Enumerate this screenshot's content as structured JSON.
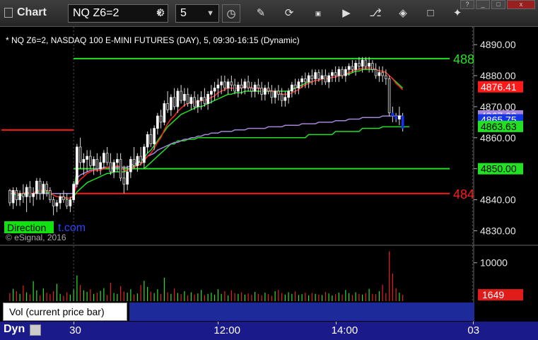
{
  "app": {
    "title": "Chart"
  },
  "toolbar": {
    "symbol": "NQ Z6=2",
    "interval": "5",
    "icons": [
      "settings-icon",
      "clock-icon",
      "pencil-icon",
      "refresh-icon",
      "get-icon",
      "play-icon",
      "link-icon",
      "comment-icon",
      "twitter-icon"
    ]
  },
  "chart_data": {
    "type": "candlestick",
    "title": "* NQ Z6=2, NASDAQ 100 E-MINI FUTURES (DAY), 5, 09:30-16:15 (Dynamic)",
    "ylim": [
      4826,
      4893
    ],
    "yticks": [
      "4890.00",
      "4880.00",
      "4870.00",
      "4860.00",
      "4850.00",
      "4840.00",
      "4830.00"
    ],
    "price_labels": [
      {
        "text": "4876.41",
        "value": 4876.41,
        "color": "#ff1a1a"
      },
      {
        "text": "4867.03",
        "value": 4867.03,
        "color": "#a585d8"
      },
      {
        "text": "4865.75",
        "value": 4865.75,
        "color": "#1535e8"
      },
      {
        "text": "4863.63",
        "value": 4863.63,
        "color": "#22e022"
      },
      {
        "text": "4850.00",
        "value": 4850.0,
        "color": "#22e022"
      }
    ],
    "level_lines": [
      {
        "value": 4862.5,
        "color": "#ff1a1a",
        "from": 0,
        "to": 21,
        "label": ""
      },
      {
        "value": 4885.5,
        "color": "#22e022",
        "from": 21,
        "to": 140,
        "label": "488"
      },
      {
        "value": 4850.0,
        "color": "#22e022",
        "from": 21,
        "to": 140,
        "label": ""
      },
      {
        "value": 4842.0,
        "color": "#ff1a1a",
        "from": 21,
        "to": 140,
        "label": "484"
      }
    ],
    "candles": [
      [
        4843,
        4843.5,
        4838,
        4839
      ],
      [
        4839,
        4844,
        4837,
        4843
      ],
      [
        4843,
        4844,
        4838,
        4840
      ],
      [
        4840,
        4843,
        4838,
        4842
      ],
      [
        4842,
        4845,
        4839,
        4841
      ],
      [
        4841,
        4845,
        4836,
        4844
      ],
      [
        4844,
        4846,
        4839,
        4841
      ],
      [
        4841,
        4844,
        4838,
        4842
      ],
      [
        4842,
        4847,
        4840,
        4846
      ],
      [
        4846,
        4847,
        4840,
        4842
      ],
      [
        4842,
        4846,
        4840,
        4845
      ],
      [
        4845,
        4846,
        4841,
        4843
      ],
      [
        4843,
        4844,
        4839,
        4840
      ],
      [
        4840,
        4841,
        4835,
        4838
      ],
      [
        4838,
        4840,
        4836,
        4839
      ],
      [
        4839,
        4842,
        4837,
        4841
      ],
      [
        4841,
        4843,
        4839,
        4840
      ],
      [
        4840,
        4842,
        4837,
        4838
      ],
      [
        4838,
        4841,
        4836,
        4840
      ],
      [
        4840,
        4846,
        4839,
        4845
      ],
      [
        4845,
        4858,
        4844,
        4857
      ],
      [
        4857,
        4860,
        4850,
        4852
      ],
      [
        4852,
        4855,
        4848,
        4853
      ],
      [
        4853,
        4856,
        4849,
        4854
      ],
      [
        4854,
        4856,
        4850,
        4851
      ],
      [
        4851,
        4854,
        4848,
        4853
      ],
      [
        4853,
        4855,
        4849,
        4850
      ],
      [
        4850,
        4854,
        4848,
        4852
      ],
      [
        4852,
        4856,
        4850,
        4855
      ],
      [
        4855,
        4857,
        4851,
        4852
      ],
      [
        4852,
        4855,
        4848,
        4849
      ],
      [
        4849,
        4853,
        4847,
        4852
      ],
      [
        4852,
        4855,
        4849,
        4853
      ],
      [
        4853,
        4855,
        4846,
        4847
      ],
      [
        4847,
        4851,
        4842,
        4845
      ],
      [
        4845,
        4851,
        4843,
        4849
      ],
      [
        4849,
        4854,
        4847,
        4853
      ],
      [
        4853,
        4857,
        4850,
        4851
      ],
      [
        4851,
        4855,
        4849,
        4854
      ],
      [
        4854,
        4857,
        4851,
        4852
      ],
      [
        4852,
        4858,
        4850,
        4857
      ],
      [
        4857,
        4862,
        4855,
        4861
      ],
      [
        4861,
        4863,
        4857,
        4858
      ],
      [
        4858,
        4864,
        4856,
        4863
      ],
      [
        4863,
        4868,
        4861,
        4867
      ],
      [
        4867,
        4869,
        4863,
        4865
      ],
      [
        4865,
        4872,
        4864,
        4871
      ],
      [
        4871,
        4875,
        4868,
        4869
      ],
      [
        4869,
        4874,
        4867,
        4873
      ],
      [
        4873,
        4876,
        4869,
        4870
      ],
      [
        4870,
        4876,
        4868,
        4875
      ],
      [
        4875,
        4877,
        4871,
        4872
      ],
      [
        4872,
        4876,
        4870,
        4874
      ],
      [
        4874,
        4876,
        4870,
        4871
      ],
      [
        4871,
        4874,
        4869,
        4873
      ],
      [
        4873,
        4875,
        4869,
        4870
      ],
      [
        4870,
        4874,
        4868,
        4872
      ],
      [
        4872,
        4875,
        4869,
        4873
      ],
      [
        4873,
        4876,
        4870,
        4871
      ],
      [
        4871,
        4875,
        4869,
        4874
      ],
      [
        4874,
        4877,
        4871,
        4875
      ],
      [
        4875,
        4878,
        4872,
        4876
      ],
      [
        4876,
        4879,
        4873,
        4877
      ],
      [
        4877,
        4880,
        4874,
        4878
      ],
      [
        4878,
        4880,
        4875,
        4876
      ],
      [
        4876,
        4879,
        4874,
        4878
      ],
      [
        4878,
        4880,
        4875,
        4877
      ],
      [
        4877,
        4879,
        4874,
        4875
      ],
      [
        4875,
        4878,
        4873,
        4877
      ],
      [
        4877,
        4879,
        4874,
        4876
      ],
      [
        4876,
        4879,
        4874,
        4878
      ],
      [
        4878,
        4880,
        4875,
        4876
      ],
      [
        4876,
        4878,
        4873,
        4875
      ],
      [
        4875,
        4878,
        4873,
        4877
      ],
      [
        4877,
        4879,
        4874,
        4876
      ],
      [
        4876,
        4878,
        4872,
        4874
      ],
      [
        4874,
        4877,
        4872,
        4876
      ],
      [
        4876,
        4878,
        4874,
        4875
      ],
      [
        4875,
        4877,
        4871,
        4873
      ],
      [
        4873,
        4876,
        4871,
        4875
      ],
      [
        4875,
        4877,
        4872,
        4874
      ],
      [
        4874,
        4876,
        4870,
        4872
      ],
      [
        4872,
        4875,
        4870,
        4873
      ],
      [
        4873,
        4876,
        4871,
        4875
      ],
      [
        4875,
        4878,
        4873,
        4877
      ],
      [
        4877,
        4879,
        4874,
        4876
      ],
      [
        4876,
        4879,
        4874,
        4878
      ],
      [
        4878,
        4880,
        4876,
        4879
      ],
      [
        4879,
        4881,
        4876,
        4878
      ],
      [
        4878,
        4881,
        4876,
        4880
      ],
      [
        4880,
        4882,
        4877,
        4879
      ],
      [
        4879,
        4882,
        4877,
        4881
      ],
      [
        4881,
        4882,
        4878,
        4879
      ],
      [
        4879,
        4882,
        4877,
        4880
      ],
      [
        4880,
        4882,
        4877,
        4878
      ],
      [
        4878,
        4881,
        4876,
        4880
      ],
      [
        4880,
        4882,
        4878,
        4881
      ],
      [
        4881,
        4883,
        4878,
        4880
      ],
      [
        4880,
        4883,
        4878,
        4882
      ],
      [
        4882,
        4883,
        4879,
        4880
      ],
      [
        4880,
        4883,
        4878,
        4882
      ],
      [
        4882,
        4884,
        4880,
        4883
      ],
      [
        4883,
        4885,
        4881,
        4882
      ],
      [
        4882,
        4885,
        4880,
        4884
      ],
      [
        4884,
        4886,
        4882,
        4883
      ],
      [
        4883,
        4886,
        4881,
        4885
      ],
      [
        4885,
        4886,
        4882,
        4883
      ],
      [
        4883,
        4886,
        4881,
        4884
      ],
      [
        4884,
        4885,
        4881,
        4882
      ],
      [
        4882,
        4884,
        4879,
        4880
      ],
      [
        4880,
        4883,
        4878,
        4881
      ],
      [
        4881,
        4883,
        4878,
        4880
      ],
      [
        4880,
        4882,
        4877,
        4879
      ],
      [
        4879,
        4880,
        4867,
        4868
      ],
      [
        4868,
        4870,
        4865,
        4867
      ],
      [
        4867,
        4868,
        4865,
        4866
      ],
      [
        4866,
        4870,
        4864,
        4867
      ],
      [
        4867,
        4868,
        4862,
        4863
      ]
    ],
    "ema_red": [
      4843,
      4842.5,
      4842,
      4842,
      4842,
      4842.5,
      4842,
      4842,
      4843,
      4843,
      4843,
      4843,
      4842.5,
      4841.5,
      4841,
      4841,
      4841,
      4840.5,
      4840.5,
      4841.5,
      4845,
      4846.5,
      4847.5,
      4848.5,
      4849,
      4849.5,
      4849.5,
      4849.5,
      4850,
      4850.5,
      4850.5,
      4850.5,
      4851,
      4850.5,
      4849.5,
      4849.5,
      4850,
      4850.5,
      4851,
      4851.5,
      4852.5,
      4854,
      4855,
      4856.5,
      4858.5,
      4860,
      4862.5,
      4864.5,
      4866,
      4867,
      4868.5,
      4869.5,
      4870.5,
      4871,
      4871.5,
      4871.5,
      4871.5,
      4872,
      4872,
      4872.5,
      4873,
      4873.5,
      4874.5,
      4875,
      4875.5,
      4876,
      4876,
      4876,
      4876,
      4876,
      4876.5,
      4876.5,
      4876,
      4876,
      4876,
      4875.5,
      4875.5,
      4875.5,
      4875,
      4875,
      4874.5,
      4874,
      4874,
      4874,
      4874.5,
      4875,
      4875.5,
      4876.5,
      4877,
      4877.5,
      4878,
      4878.5,
      4878.5,
      4879,
      4879,
      4879,
      4879.5,
      4879.5,
      4880,
      4880,
      4880.5,
      4881,
      4881.5,
      4882,
      4882,
      4882.5,
      4882.5,
      4882.5,
      4882.5,
      4882,
      4881.5,
      4881.5,
      4881,
      4880,
      4879,
      4877.5,
      4876.5,
      4875.5
    ],
    "ema_green": [
      4842,
      4842,
      4841.5,
      4841.5,
      4841.5,
      4842,
      4842,
      4842,
      4842.5,
      4842.5,
      4842.5,
      4842.5,
      4842,
      4841.5,
      4841,
      4841,
      4840.5,
      4840.5,
      4840.5,
      4841,
      4842.5,
      4843.5,
      4844.5,
      4845.5,
      4846,
      4846.5,
      4847,
      4847.5,
      4848,
      4848.5,
      4848.5,
      4849,
      4849,
      4849,
      4849,
      4849.5,
      4850,
      4851,
      4851.5,
      4852.5,
      4853.5,
      4855,
      4856,
      4857.5,
      4859,
      4860.5,
      4862,
      4863.5,
      4864.5,
      4865.5,
      4866.5,
      4867.5,
      4868,
      4868.5,
      4869,
      4869.5,
      4870,
      4870,
      4870.5,
      4871,
      4871.5,
      4872,
      4872.5,
      4873,
      4873.5,
      4874,
      4874,
      4874.5,
      4874.5,
      4874.5,
      4875,
      4875,
      4875,
      4875,
      4875,
      4875,
      4875,
      4875,
      4875,
      4875,
      4875,
      4875,
      4875,
      4875,
      4875.5,
      4876,
      4876.5,
      4877,
      4877.5,
      4878,
      4878,
      4878.5,
      4878.5,
      4879,
      4879,
      4879,
      4879.5,
      4879.5,
      4880,
      4880,
      4880.5,
      4880.5,
      4881,
      4881.5,
      4881.5,
      4882,
      4882,
      4882,
      4882,
      4882,
      4881.5,
      4881.5,
      4881,
      4880,
      4879,
      4878,
      4877,
      4876
    ],
    "vwap_purple": [
      4842,
      4842,
      4842,
      4842,
      4842,
      4842,
      4842,
      4842,
      4842,
      4842,
      4842,
      4842,
      4842,
      4842,
      4842,
      4842,
      4842,
      4842,
      4842,
      4842,
      4847,
      4848,
      4848.5,
      4849,
      4849.5,
      4849.5,
      4850,
      4850,
      4850.5,
      4850.5,
      4850.5,
      4850.5,
      4850.5,
      4850.5,
      4850.5,
      4850.5,
      4851,
      4851.5,
      4852,
      4852.5,
      4853,
      4854,
      4854.5,
      4855,
      4856,
      4856.5,
      4857,
      4857.5,
      4858,
      4858.5,
      4858.5,
      4859,
      4859.5,
      4859.5,
      4860,
      4860,
      4860.5,
      4860.5,
      4861,
      4861,
      4861.5,
      4861.5,
      4861.5,
      4862,
      4862,
      4862,
      4862,
      4862.5,
      4862.5,
      4862.5,
      4862.5,
      4863,
      4863,
      4863,
      4863,
      4863,
      4863,
      4863.5,
      4863.5,
      4863.5,
      4863.5,
      4863.5,
      4864,
      4864,
      4864,
      4864,
      4864,
      4864.5,
      4864.5,
      4864.5,
      4864.5,
      4864.5,
      4865,
      4865,
      4865,
      4865,
      4865,
      4865.5,
      4865.5,
      4865.5,
      4865.5,
      4866,
      4866,
      4866,
      4866,
      4866.5,
      4866.5,
      4866.5,
      4866.5,
      4866.5,
      4866.5,
      4867,
      4867,
      4867,
      4867,
      4867,
      4867,
      4867
    ],
    "green_step": [
      4842,
      4842,
      4842,
      4842,
      4842,
      4842,
      4842,
      4842,
      4842,
      4842,
      4842,
      4842,
      4842,
      4842,
      4842,
      4842,
      4842,
      4842,
      4842,
      4842,
      4850,
      4850,
      4850,
      4850,
      4850,
      4850,
      4850,
      4850,
      4850,
      4850,
      4850,
      4850,
      4850,
      4850,
      4850,
      4850,
      4850,
      4850,
      4850,
      4850,
      4850,
      4851,
      4852,
      4853,
      4854,
      4855,
      4856,
      4857,
      4858,
      4858,
      4859,
      4859,
      4859,
      4859.5,
      4859.5,
      4859.5,
      4860,
      4860,
      4860,
      4860,
      4860,
      4860,
      4860,
      4860,
      4860,
      4860,
      4860,
      4860,
      4860,
      4860,
      4860,
      4860,
      4860,
      4860,
      4860,
      4860,
      4860,
      4860,
      4860,
      4860,
      4860,
      4860,
      4860,
      4860,
      4860,
      4860,
      4860,
      4860,
      4860,
      4861,
      4861,
      4861,
      4861,
      4861,
      4861,
      4861,
      4861,
      4862,
      4862,
      4862,
      4862,
      4862,
      4862,
      4862,
      4862,
      4863,
      4863,
      4863,
      4863,
      4863,
      4863,
      4863.5,
      4863.5,
      4863.5,
      4863.5,
      4863.5,
      4863.5,
      4863.5,
      4863.5,
      4863.5
    ],
    "volume": {
      "ylim": [
        0,
        14000
      ],
      "yticks": [
        "10000"
      ],
      "label_value": {
        "text": "1649",
        "value": 1649,
        "color": "#e11a1a"
      },
      "bars": [
        2100,
        3200,
        2600,
        1900,
        4100,
        2300,
        1700,
        5200,
        2800,
        1500,
        3300,
        2200,
        1800,
        2600,
        4500,
        1900,
        1400,
        2300,
        1700,
        3000,
        6700,
        4200,
        2800,
        2400,
        3100,
        1900,
        2200,
        2700,
        3400,
        1600,
        4800,
        2100,
        1900,
        3900,
        2500,
        2200,
        3100,
        1700,
        2000,
        4200,
        5300,
        3700,
        2500,
        2100,
        3100,
        1900,
        6100,
        2300,
        1900,
        3300,
        2100,
        1800,
        2600,
        1500,
        2300,
        1700,
        2000,
        2900,
        1600,
        1900,
        2200,
        1700,
        3100,
        1900,
        2600,
        1500,
        2800,
        2100,
        1900,
        2300,
        1700,
        2000,
        1600,
        2400,
        1900,
        1500,
        2200,
        1800,
        1400,
        2600,
        2900,
        2100,
        1700,
        2300,
        1900,
        2500,
        1600,
        1800,
        2200,
        1500,
        2100,
        1900,
        1700,
        1600,
        2400,
        2000,
        1500,
        1800,
        2200,
        1700,
        2900,
        2100,
        1600,
        2300,
        1900,
        1700,
        2100,
        3200,
        1900,
        1800,
        2600,
        4300,
        2100,
        13000,
        7200,
        3400,
        2200,
        1649
      ]
    },
    "x_labels": [
      {
        "text": "30",
        "index": 21
      },
      {
        "text": "12:00",
        "index": 64
      },
      {
        "text": "14:00",
        "index": 99
      },
      {
        "text": "03",
        "index": 140
      }
    ],
    "annotations": {
      "watermark": "© eSignal, 2016",
      "brand_left": "Direction",
      "brand_right": "t.com"
    }
  },
  "lower_pane": {
    "label": "Vol (current price bar)",
    "close_glyph": "x"
  },
  "bottom": {
    "dyn_label": "Dyn"
  }
}
